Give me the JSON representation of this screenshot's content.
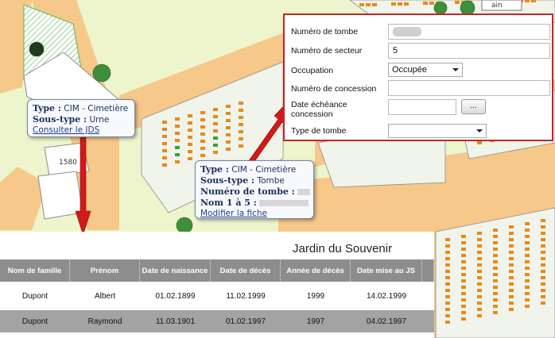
{
  "colors": {
    "map_background": "#f0f6cf",
    "path_orange": "#f6c889",
    "cemetery_hatch": "#5fb45c",
    "grave_orange": "#e68a1c",
    "grave_green": "#3aa236",
    "form_border": "#c0262a",
    "tooltip_border": "#6f84a6",
    "arrow_red": "#d11a1a",
    "table_header": "#8d8d8d"
  },
  "map": {
    "building_label": "1580",
    "street_fragment": "ain"
  },
  "tooltip_jds": {
    "type_label": "Type :",
    "type_value": "CIM - Cimetière",
    "subtype_label": "Sous-type :",
    "subtype_value": "Urne",
    "link": "Consulter le JDS"
  },
  "tooltip_tombe": {
    "type_label": "Type :",
    "type_value": "CIM - Cimetière",
    "subtype_label": "Sous-type :",
    "subtype_value": "Tombe",
    "numero_label": "Numéro de tombe :",
    "nom_label": "Nom 1 à 5 :",
    "link": "Modifier la fiche"
  },
  "form": {
    "numero_tombe_label": "Numéro de tombe",
    "numero_secteur_label": "Numéro de secteur",
    "numero_secteur_value": "5",
    "occupation_label": "Occupation",
    "occupation_value": "Occupée",
    "numero_concession_label": "Numéro de concession",
    "date_echeance_label_1": "Date échéance",
    "date_echeance_label_2": "concession",
    "browse_label": "...",
    "type_tombe_label": "Type de tombe"
  },
  "table": {
    "title": "Jardin du Souvenir",
    "columns": [
      "Nom de famille",
      "Prénom",
      "Date de naissance",
      "Date de décès",
      "Année de décès",
      "Date mise au JS"
    ],
    "rows": [
      [
        "Dupont",
        "Albert",
        "01.02.1899",
        "11.02.1999",
        "1999",
        "14.02.1999"
      ],
      [
        "Dupont",
        "Raymond",
        "11.03.1901",
        "01.02.1997",
        "1997",
        "04.02.1997"
      ]
    ]
  }
}
